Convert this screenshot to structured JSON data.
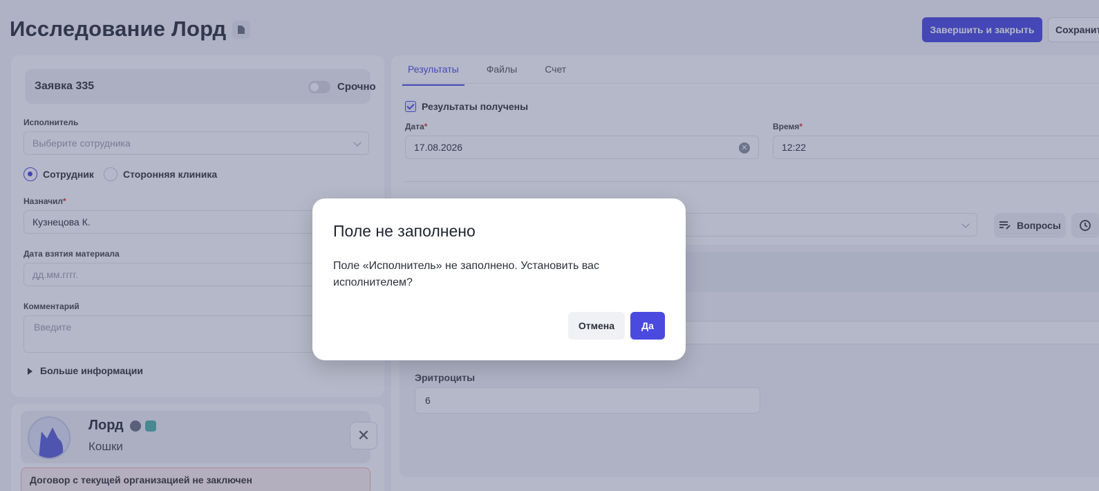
{
  "header": {
    "title": "Исследование Лорд",
    "finish_button": "Завершить и закрыть",
    "save_button": "Сохранить"
  },
  "request": {
    "title": "Заявка 335",
    "urgent_label": "Срочно",
    "urgent_on": false
  },
  "form": {
    "executor_label": "Исполнитель",
    "executor_placeholder": "Выберите сотрудника",
    "radio_employee": "Сотрудник",
    "radio_external": "Сторонняя клиника",
    "assigned_label": "Назначил",
    "assigned_value": "Кузнецова К.",
    "material_date_label": "Дата взятия материала",
    "material_date_placeholder": "дд.мм.гггг.",
    "comment_label": "Комментарий",
    "comment_placeholder": "Введите",
    "more_info": "Больше информации"
  },
  "patient": {
    "name": "Лорд",
    "species": "Кошки",
    "contract_warning": "Договор с текущей организацией не заключен"
  },
  "tabs": [
    {
      "label": "Результаты",
      "active": true
    },
    {
      "label": "Файлы",
      "active": false
    },
    {
      "label": "Счет",
      "active": false
    }
  ],
  "results": {
    "received_label": "Результаты получены",
    "received_checked": true,
    "date_label": "Дата",
    "date_value": "17.08.2026",
    "time_label": "Время",
    "time_value": "12:22",
    "questions_button": "Вопросы",
    "erythrocytes_label": "Эритроциты",
    "erythrocytes_value": "6"
  },
  "modal": {
    "title": "Поле не заполнено",
    "text": "Поле «Исполнитель» не заполнено. Установить вас исполнителем?",
    "cancel": "Отмена",
    "confirm": "Да"
  },
  "colors": {
    "accent": "#4a4ae0",
    "overlay": "#3c446e"
  }
}
